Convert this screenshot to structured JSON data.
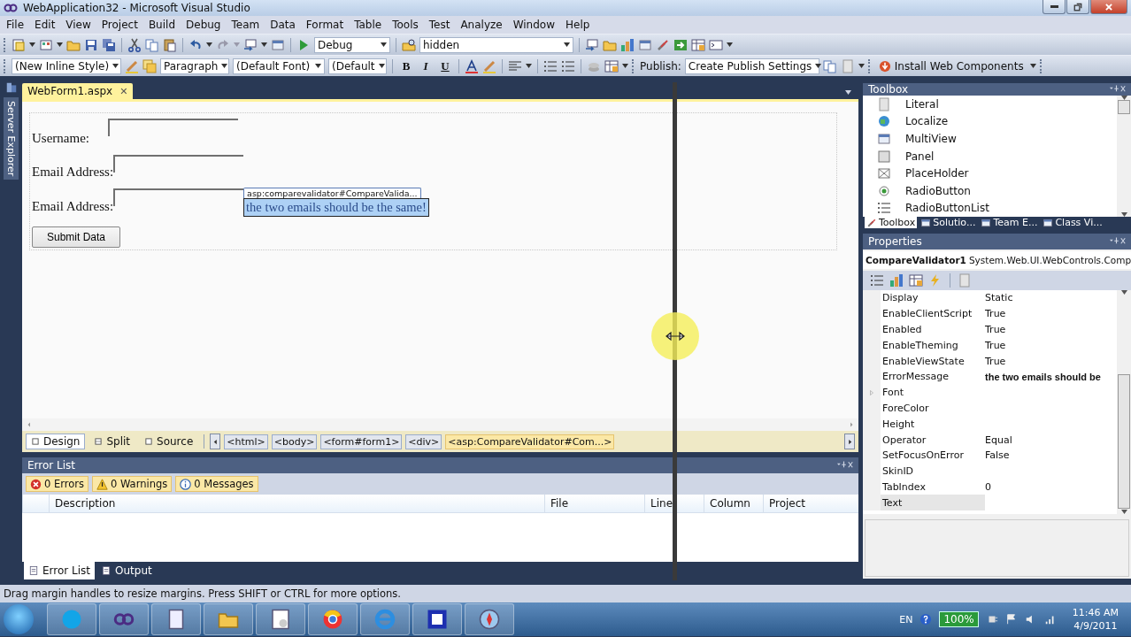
{
  "window": {
    "title": "WebApplication32 - Microsoft Visual Studio"
  },
  "menu": [
    "File",
    "Edit",
    "View",
    "Project",
    "Build",
    "Debug",
    "Team",
    "Data",
    "Format",
    "Table",
    "Tools",
    "Test",
    "Analyze",
    "Window",
    "Help"
  ],
  "standard_toolbar": {
    "configuration": "Debug",
    "find": "hidden"
  },
  "formatting_toolbar": {
    "style": "(New Inline Style)",
    "block": "Paragraph",
    "font": "(Default Font)",
    "size": "(Default",
    "bold": "B",
    "italic": "I",
    "underline": "U",
    "publish_label": "Publish:",
    "publish": "Create Publish Settings",
    "install": "Install Web Components"
  },
  "side_tab": "Server Explorer",
  "document": {
    "tab": "WebForm1.aspx",
    "close": "✕",
    "form": {
      "fields": [
        {
          "label": "Username:"
        },
        {
          "label": "Email Address:"
        },
        {
          "label": "Email Address:"
        }
      ],
      "validator_tag": "asp:comparevalidator#CompareValida...",
      "validator_message": "the two emails should be the same!",
      "submit": "Submit Data"
    },
    "views": [
      {
        "label": "Design",
        "selected": true
      },
      {
        "label": "Split",
        "selected": false
      },
      {
        "label": "Source",
        "selected": false
      }
    ],
    "breadcrumbs": [
      {
        "label": "<html>",
        "selected": false
      },
      {
        "label": "<body>",
        "selected": false
      },
      {
        "label": "<form#form1>",
        "selected": false
      },
      {
        "label": "<div>",
        "selected": false
      },
      {
        "label": "<asp:CompareValidator#Com...>",
        "selected": true
      }
    ]
  },
  "error_list": {
    "title": "Error List",
    "filters": [
      {
        "kind": "error",
        "label": "0 Errors"
      },
      {
        "kind": "warning",
        "label": "0 Warnings"
      },
      {
        "kind": "info",
        "label": "0 Messages"
      }
    ],
    "columns": [
      "Description",
      "File",
      "Line",
      "Column",
      "Project"
    ],
    "tabs": [
      {
        "label": "Error List",
        "selected": true
      },
      {
        "label": "Output",
        "selected": false
      }
    ]
  },
  "toolbox": {
    "title": "Toolbox",
    "items": [
      "Literal",
      "Localize",
      "MultiView",
      "Panel",
      "PlaceHolder",
      "RadioButton",
      "RadioButtonList"
    ],
    "tabs": [
      {
        "label": "Toolbox",
        "selected": true
      },
      {
        "label": "Solutio...",
        "selected": false
      },
      {
        "label": "Team E...",
        "selected": false
      },
      {
        "label": "Class Vi...",
        "selected": false
      }
    ]
  },
  "properties": {
    "title": "Properties",
    "object": "CompareValidator1",
    "type": "System.Web.UI.WebControls.Comp",
    "rows": [
      {
        "name": "Display",
        "value": "Static",
        "modified": false,
        "expandable": false,
        "selected": false
      },
      {
        "name": "EnableClientScript",
        "value": "True",
        "modified": false,
        "expandable": false,
        "selected": false
      },
      {
        "name": "Enabled",
        "value": "True",
        "modified": false,
        "expandable": false,
        "selected": false
      },
      {
        "name": "EnableTheming",
        "value": "True",
        "modified": false,
        "expandable": false,
        "selected": false
      },
      {
        "name": "EnableViewState",
        "value": "True",
        "modified": false,
        "expandable": false,
        "selected": false
      },
      {
        "name": "ErrorMessage",
        "value": "the two emails should be",
        "modified": true,
        "expandable": false,
        "selected": false
      },
      {
        "name": "Font",
        "expandable": true,
        "modified": false,
        "selected": false
      },
      {
        "name": "ForeColor",
        "modified": false,
        "expandable": false,
        "selected": false
      },
      {
        "name": "Height",
        "modified": false,
        "expandable": false,
        "selected": false
      },
      {
        "name": "Operator",
        "value": "Equal",
        "modified": false,
        "expandable": false,
        "selected": false
      },
      {
        "name": "SetFocusOnError",
        "value": "False",
        "modified": false,
        "expandable": false,
        "selected": false
      },
      {
        "name": "SkinID",
        "modified": false,
        "expandable": false,
        "selected": false
      },
      {
        "name": "TabIndex",
        "value": "0",
        "modified": false,
        "expandable": false,
        "selected": false
      },
      {
        "name": "Text",
        "modified": false,
        "expandable": false,
        "selected": true
      }
    ]
  },
  "status_bar": "Drag margin handles to resize margins. Press SHIFT or CTRL for more options.",
  "taskbar": {
    "language": "EN",
    "battery": "100%",
    "time": "11:46 AM",
    "date": "4/9/2011"
  }
}
